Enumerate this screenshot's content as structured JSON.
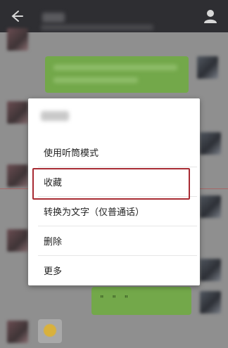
{
  "colors": {
    "topbar": "#2e2e32",
    "chat_dim": "#8f8f8f",
    "bubble_green": "#73a84a",
    "menu_bg": "#ffffff",
    "highlight": "#a82b33"
  },
  "topbar": {
    "back_icon": "arrow-left-icon",
    "profile_icon": "person-icon"
  },
  "menu": {
    "items": [
      {
        "label": "使用听筒模式"
      },
      {
        "label": "收藏"
      },
      {
        "label": "转换为文字（仅普通话）"
      },
      {
        "label": "删除"
      },
      {
        "label": "更多"
      }
    ],
    "highlighted_index": 1
  },
  "chat": {
    "voice_bubble_text": "\" \" \""
  }
}
